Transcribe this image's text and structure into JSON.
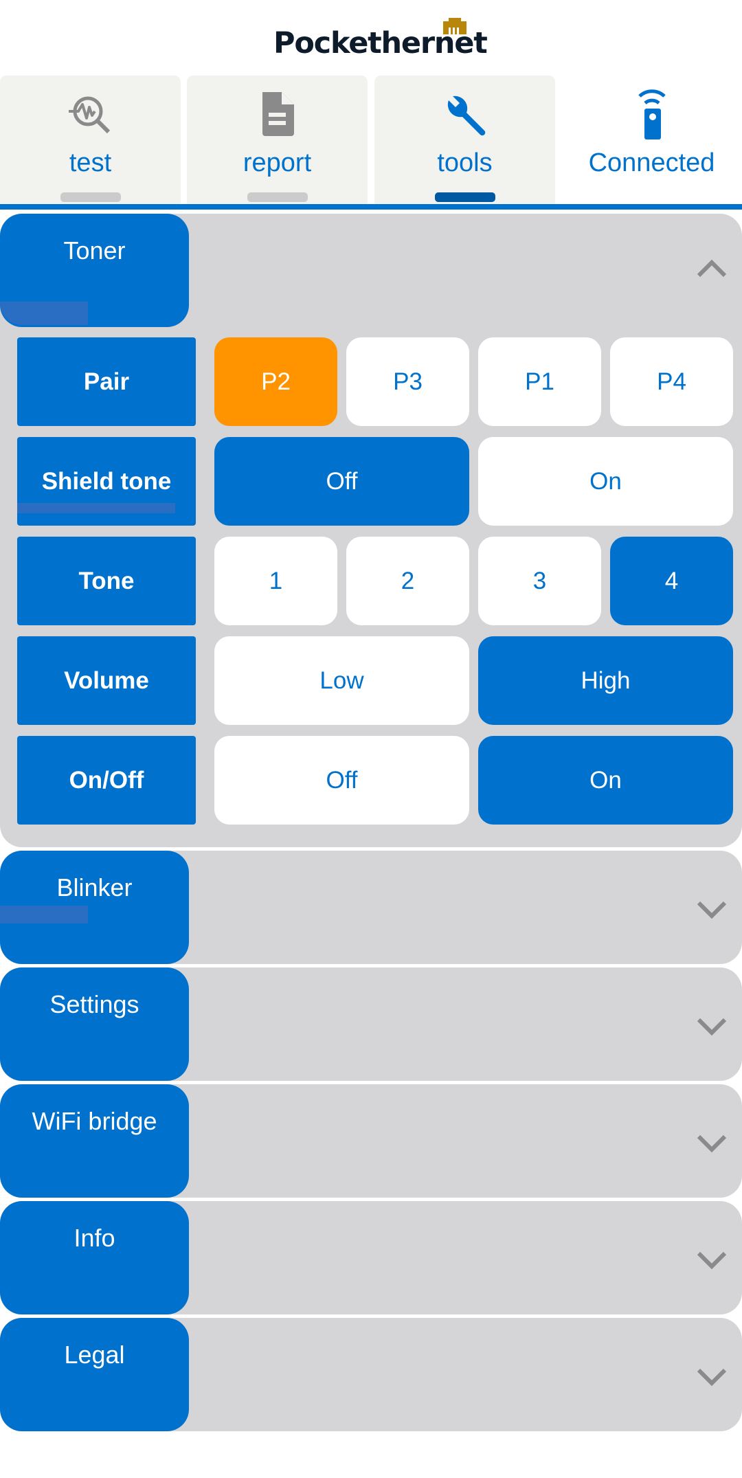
{
  "logo": {
    "text": "Pockethernet",
    "icon": "ethernet-jack-icon",
    "icon_color": "#b8860b"
  },
  "tabs": [
    {
      "label": "test",
      "icon": "search-pulse-icon",
      "active": false
    },
    {
      "label": "report",
      "icon": "document-icon",
      "active": false
    },
    {
      "label": "tools",
      "icon": "wrench-icon",
      "active": true
    },
    {
      "label": "Connected",
      "icon": "remote-wifi-icon",
      "active": false
    }
  ],
  "colors": {
    "primary": "#0071cc",
    "accent_orange": "#ff9300",
    "panel_bg": "#d5d5d7",
    "tab_bg": "#f2f2ef",
    "chevron": "#8a8a8a"
  },
  "toner": {
    "title": "Toner",
    "expanded": true,
    "rows": [
      {
        "label": "Pair",
        "options": [
          "P2",
          "P3",
          "P1",
          "P4"
        ],
        "selected": "P2"
      },
      {
        "label": "Shield tone",
        "options": [
          "Off",
          "On"
        ],
        "selected": "Off"
      },
      {
        "label": "Tone",
        "options": [
          "1",
          "2",
          "3",
          "4"
        ],
        "selected": "4"
      },
      {
        "label": "Volume",
        "options": [
          "Low",
          "High"
        ],
        "selected": "High"
      },
      {
        "label": "On/Off",
        "options": [
          "Off",
          "On"
        ],
        "selected": "On"
      }
    ]
  },
  "sections": [
    {
      "title": "Blinker",
      "expanded": false
    },
    {
      "title": "Settings",
      "expanded": false
    },
    {
      "title": "WiFi bridge",
      "expanded": false
    },
    {
      "title": "Info",
      "expanded": false
    },
    {
      "title": "Legal",
      "expanded": false
    }
  ]
}
